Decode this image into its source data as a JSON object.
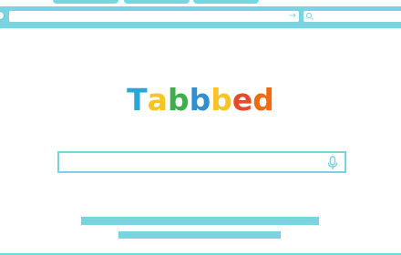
{
  "colors": {
    "accent": "#7ad3e0",
    "background": "#ffffff"
  },
  "logo": {
    "text": "Tabbbed",
    "letters": [
      {
        "char": "T",
        "color": "#28a6d6"
      },
      {
        "char": "a",
        "color": "#f8c326"
      },
      {
        "char": "b",
        "color": "#3caf4a"
      },
      {
        "char": "b",
        "color": "#2f8fd1"
      },
      {
        "char": "b",
        "color": "#f8c326"
      },
      {
        "char": "e",
        "color": "#e8482b"
      },
      {
        "char": "d",
        "color": "#f06a12"
      }
    ]
  },
  "toolbar": {
    "address_value": "",
    "go_icon": "arrow-right-icon",
    "search_value": "",
    "search_icon": "search-icon"
  },
  "main_search": {
    "value": "",
    "mic_icon": "microphone-icon"
  }
}
